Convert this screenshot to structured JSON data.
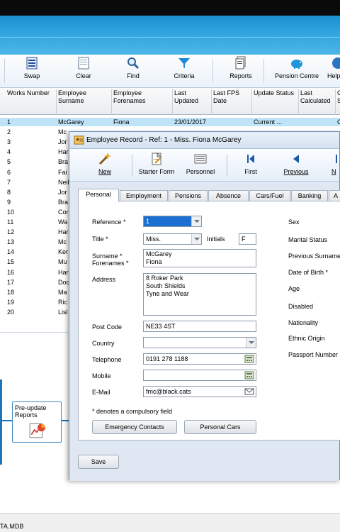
{
  "toolbar": {
    "items": [
      {
        "label": "Swap",
        "icon": "swap-icon"
      },
      {
        "label": "Clear",
        "icon": "clear-icon"
      },
      {
        "label": "Find",
        "icon": "find-icon"
      },
      {
        "label": "Criteria",
        "icon": "criteria-icon"
      },
      {
        "label": "Reports",
        "icon": "reports-icon"
      },
      {
        "label": "Pension Centre",
        "icon": "pension-centre-icon"
      },
      {
        "label": "Help",
        "icon": "help-icon"
      }
    ]
  },
  "grid": {
    "headers": [
      "Works Number",
      "Employee Surname",
      "Employee Forenames",
      "Last Updated",
      "Last FPS Date",
      "Update Status",
      "Last Calculated",
      "C S"
    ],
    "rows": [
      {
        "num": "1",
        "surname": "McGarey",
        "forenames": "Fiona",
        "updated": "23/01/2017",
        "status": "Current ...",
        "extra": "C"
      },
      {
        "num": "2",
        "surname": "Mc",
        "forenames": "",
        "updated": "",
        "status": "",
        "extra": ""
      },
      {
        "num": "3",
        "surname": "Jor",
        "forenames": "",
        "updated": "",
        "status": "",
        "extra": ""
      },
      {
        "num": "4",
        "surname": "Har",
        "forenames": "",
        "updated": "",
        "status": "",
        "extra": ""
      },
      {
        "num": "5",
        "surname": "Bra",
        "forenames": "",
        "updated": "",
        "status": "",
        "extra": ""
      },
      {
        "num": "6",
        "surname": "Fai",
        "forenames": "",
        "updated": "",
        "status": "",
        "extra": ""
      },
      {
        "num": "7",
        "surname": "Neil",
        "forenames": "",
        "updated": "",
        "status": "",
        "extra": ""
      },
      {
        "num": "8",
        "surname": "Jor",
        "forenames": "",
        "updated": "",
        "status": "",
        "extra": ""
      },
      {
        "num": "9",
        "surname": "Bra",
        "forenames": "",
        "updated": "",
        "status": "",
        "extra": ""
      },
      {
        "num": "10",
        "surname": "Cor",
        "forenames": "",
        "updated": "",
        "status": "",
        "extra": ""
      },
      {
        "num": "11",
        "surname": "Wa",
        "forenames": "",
        "updated": "",
        "status": "",
        "extra": ""
      },
      {
        "num": "12",
        "surname": "Har",
        "forenames": "",
        "updated": "",
        "status": "",
        "extra": ""
      },
      {
        "num": "13",
        "surname": "Mc",
        "forenames": "",
        "updated": "",
        "status": "",
        "extra": ""
      },
      {
        "num": "14",
        "surname": "Ker",
        "forenames": "",
        "updated": "",
        "status": "",
        "extra": ""
      },
      {
        "num": "15",
        "surname": "Mu",
        "forenames": "",
        "updated": "",
        "status": "",
        "extra": ""
      },
      {
        "num": "16",
        "surname": "Har",
        "forenames": "",
        "updated": "",
        "status": "",
        "extra": ""
      },
      {
        "num": "17",
        "surname": "Doc",
        "forenames": "",
        "updated": "",
        "status": "",
        "extra": ""
      },
      {
        "num": "18",
        "surname": "Ma",
        "forenames": "",
        "updated": "",
        "status": "",
        "extra": ""
      },
      {
        "num": "19",
        "surname": "Ric",
        "forenames": "",
        "updated": "",
        "status": "",
        "extra": ""
      },
      {
        "num": "20",
        "surname": "Lisl",
        "forenames": "",
        "updated": "",
        "status": "",
        "extra": ""
      }
    ]
  },
  "flow": {
    "box_label": "Pre-update\nReports"
  },
  "status_bar": {
    "text": "TA.MDB"
  },
  "dialog": {
    "title": "Employee Record - Ref: 1 - Miss. Fiona McGarey",
    "toolbar": [
      {
        "label": "New",
        "icon": "new-icon"
      },
      {
        "label": "Starter Form",
        "icon": "starter-form-icon"
      },
      {
        "label": "Personnel",
        "icon": "personnel-icon"
      },
      {
        "label": "First",
        "icon": "first-icon"
      },
      {
        "label": "Previous",
        "icon": "previous-icon"
      },
      {
        "label": "N",
        "icon": "next-icon"
      }
    ],
    "tabs": [
      "Personal",
      "Employment",
      "Pensions",
      "Absence",
      "Cars/Fuel",
      "Banking",
      "A"
    ],
    "fields": {
      "reference_label": "Reference *",
      "reference_value": "1",
      "title_label": "Title *",
      "title_value": "Miss.",
      "initials_label": "Initials",
      "initials_value": "F",
      "surname_label": "Surname *",
      "forenames_label": "Forenames *",
      "surname_value": "McGarey",
      "forenames_value": "Fiona",
      "address_label": "Address",
      "address_value": "8 Roker Park\nSouth Shields\nTyne and Wear",
      "postcode_label": "Post Code",
      "postcode_value": "NE33 4ST",
      "country_label": "Country",
      "country_value": "",
      "telephone_label": "Telephone",
      "telephone_value": "0191 278 1188",
      "mobile_label": "Mobile",
      "mobile_value": "",
      "email_label": "E-Mail",
      "email_value": "fmc@black.cats",
      "compulsory_note": "* denotes a compulsory field"
    },
    "right_labels": [
      "Sex",
      "Marital Status",
      "Previous Surname",
      "Date of Birth *",
      "Age",
      "Disabled",
      "Nationality",
      "Ethnic Origin",
      "Passport Number"
    ],
    "buttons": {
      "emergency": "Emergency Contacts",
      "cars": "Personal Cars",
      "save": "Save"
    }
  }
}
